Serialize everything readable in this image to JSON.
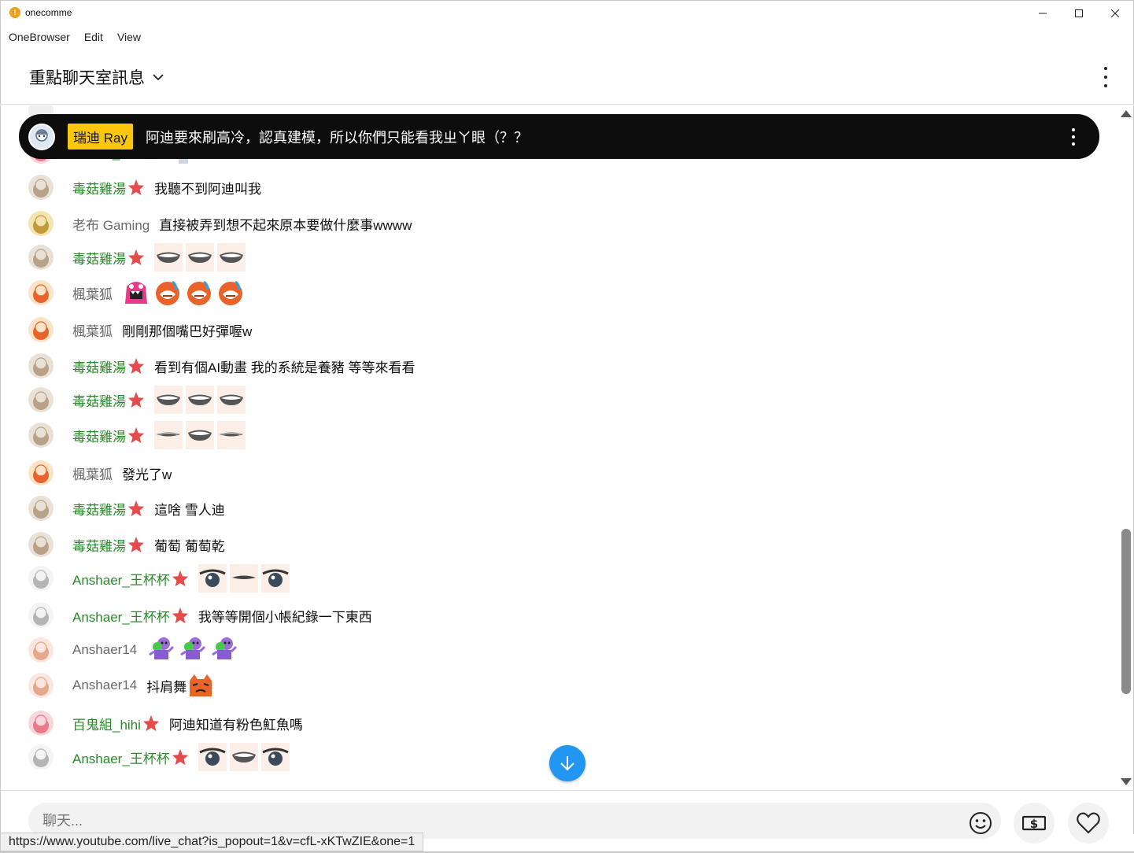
{
  "window": {
    "title": "onecomme"
  },
  "menu": [
    "OneBrowser",
    "Edit",
    "View"
  ],
  "header": {
    "title": "重點聊天室訊息"
  },
  "pinned": {
    "author": "瑞迪 Ray",
    "text": "阿迪要來刷高冷，認真建模，所以你們只能看我ㄓㄚ眼（？？"
  },
  "colors": {
    "member_name": "#2a8a2a",
    "normal_name": "#6a6a6a",
    "pinned_author_bg": "#f9c80e",
    "jump_button": "#2196f3"
  },
  "messages": [
    {
      "author": "百鬼組_hihi",
      "member": true,
      "text": "",
      "emojis": [
        "girl-sticker"
      ]
    },
    {
      "author": "毒菇雞湯",
      "member": true,
      "text": "我聽不到阿迪叫我",
      "emojis": []
    },
    {
      "author": "老布 Gaming",
      "member": false,
      "text": "直接被弄到想不起來原本要做什麼事wwww",
      "emojis": []
    },
    {
      "author": "毒菇雞湯",
      "member": true,
      "text": "",
      "emojis": [
        "grin-mouth",
        "grin-mouth",
        "grin-mouth"
      ]
    },
    {
      "author": "楓葉狐",
      "member": false,
      "text": "",
      "emojis": [
        "pink-monster",
        "orange-face",
        "orange-face",
        "orange-face"
      ]
    },
    {
      "author": "楓葉狐",
      "member": false,
      "text": "剛剛那個嘴巴好彈喔w",
      "emojis": []
    },
    {
      "author": "毒菇雞湯",
      "member": true,
      "text": "看到有個AI動畫 我的系統是養豬 等等來看看",
      "emojis": []
    },
    {
      "author": "毒菇雞湯",
      "member": true,
      "text": "",
      "emojis": [
        "grin-mouth",
        "grin-mouth",
        "grin-mouth"
      ]
    },
    {
      "author": "毒菇雞湯",
      "member": true,
      "text": "",
      "emojis": [
        "flat-mouth",
        "grin-mouth",
        "flat-mouth"
      ]
    },
    {
      "author": "楓葉狐",
      "member": false,
      "text": "發光了w",
      "emojis": []
    },
    {
      "author": "毒菇雞湯",
      "member": true,
      "text": "這啥 雪人迪",
      "emojis": []
    },
    {
      "author": "毒菇雞湯",
      "member": true,
      "text": "葡萄 葡萄乾",
      "emojis": []
    },
    {
      "author": "Anshaer_王杯杯",
      "member": true,
      "text": "",
      "emojis": [
        "eye",
        "closed-eye",
        "eye"
      ]
    },
    {
      "author": "Anshaer_王杯杯",
      "member": true,
      "text": "我等等開個小帳紀錄一下東西",
      "emojis": []
    },
    {
      "author": "Anshaer14",
      "member": false,
      "text": "",
      "emojis": [
        "dancing-purple",
        "dancing-purple",
        "dancing-purple"
      ]
    },
    {
      "author": "Anshaer14",
      "member": false,
      "text": "抖肩舞",
      "emojis": [
        "orange-tiger"
      ]
    },
    {
      "author": "百鬼組_hihi",
      "member": true,
      "text": "阿迪知道有粉色魟魚嗎",
      "emojis": []
    },
    {
      "author": "Anshaer_王杯杯",
      "member": true,
      "text": "",
      "emojis": [
        "eye",
        "grin-mouth",
        "eye"
      ]
    }
  ],
  "input": {
    "placeholder": "聊天..."
  },
  "status": {
    "url": "https://www.youtube.com/live_chat?is_popout=1&v=cfL-xKTwZIE&one=1"
  }
}
